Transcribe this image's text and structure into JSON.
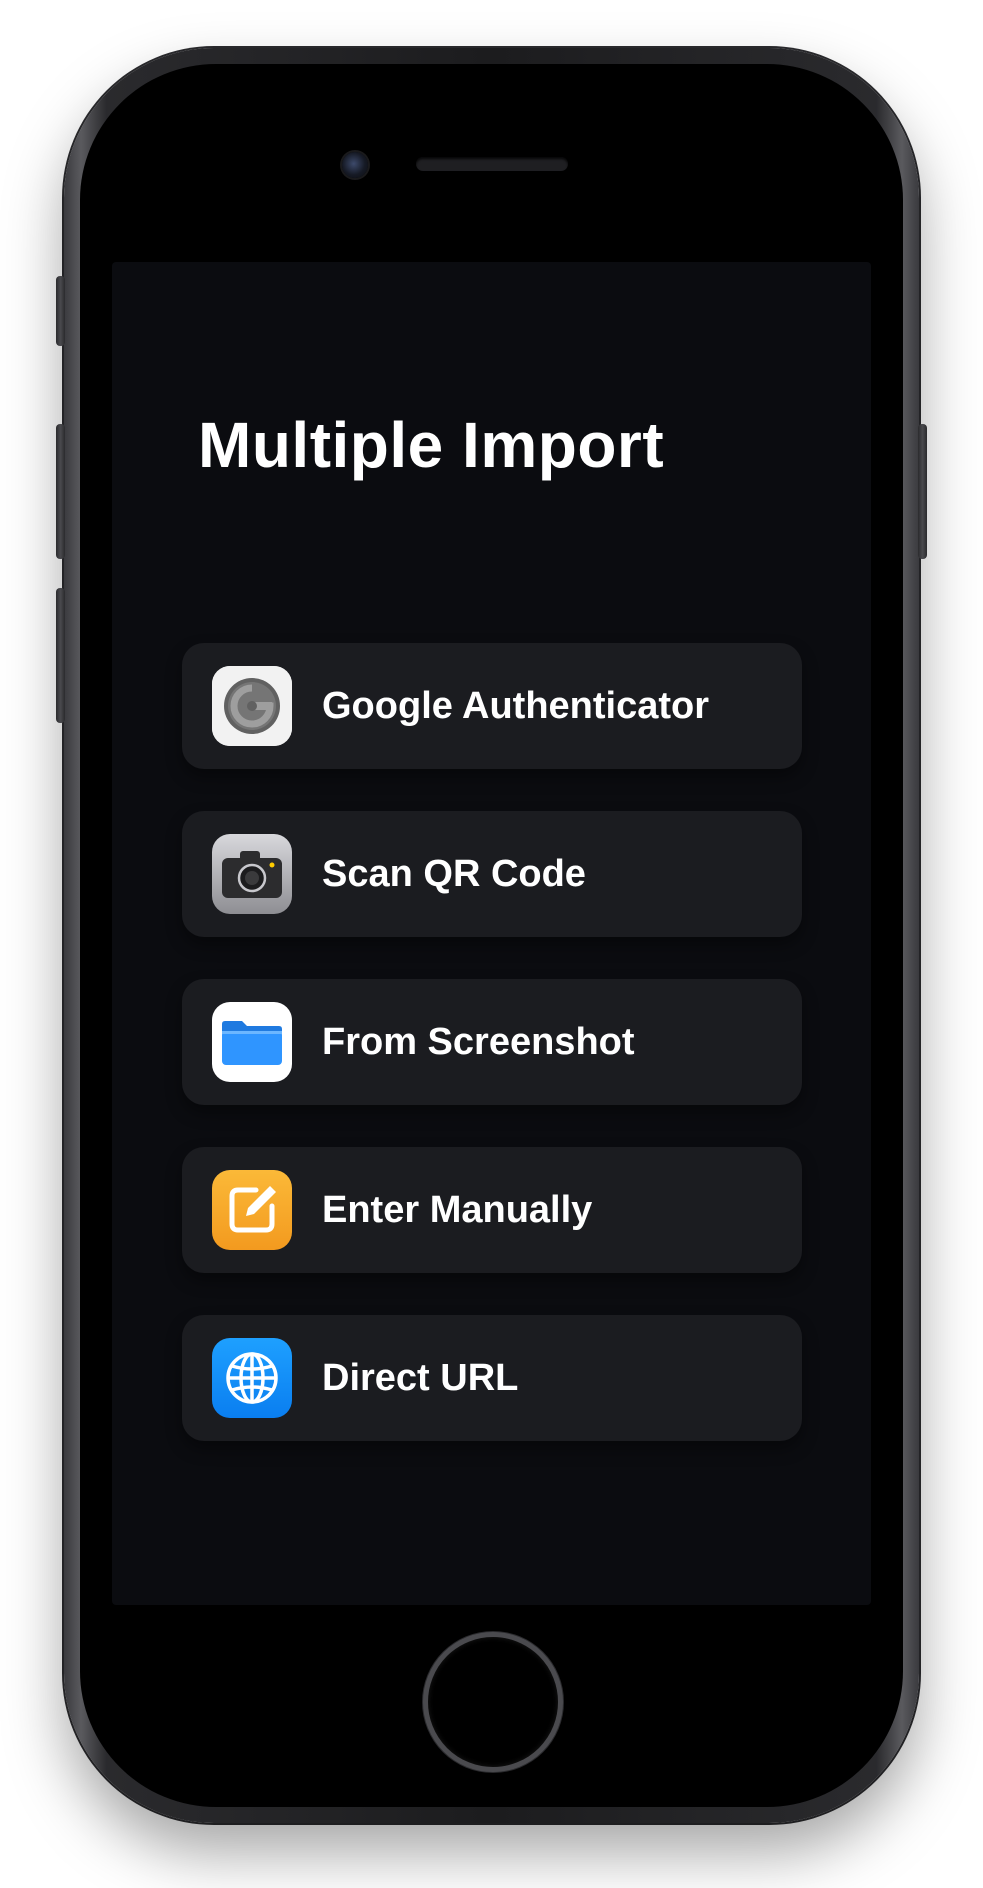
{
  "screen": {
    "title": "Multiple Import"
  },
  "options": [
    {
      "label": "Google Authenticator",
      "icon": "google-authenticator-icon",
      "icon_bg": "#f2f2f2"
    },
    {
      "label": "Scan QR Code",
      "icon": "camera-icon",
      "icon_bg": "#8e8e93"
    },
    {
      "label": "From Screenshot",
      "icon": "folder-icon",
      "icon_bg": "#ffffff"
    },
    {
      "label": "Enter Manually",
      "icon": "compose-icon",
      "icon_bg": "#f7a928"
    },
    {
      "label": "Direct URL",
      "icon": "globe-icon",
      "icon_bg": "#1a8cff"
    }
  ],
  "colors": {
    "screen_bg": "#0b0c10",
    "card_bg": "#1b1c20",
    "text": "#ffffff"
  }
}
